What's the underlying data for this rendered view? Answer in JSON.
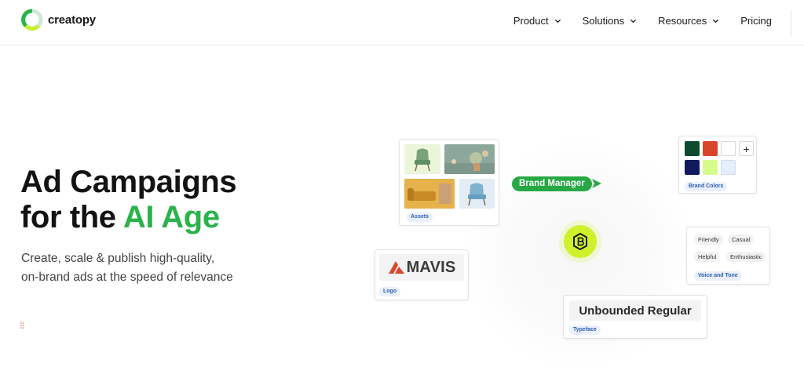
{
  "brand": {
    "name": "creatopy"
  },
  "nav": {
    "items": [
      {
        "label": "Product"
      },
      {
        "label": "Solutions"
      },
      {
        "label": "Resources"
      },
      {
        "label": "Pricing"
      }
    ]
  },
  "hero": {
    "title_line1": "Ad Campaigns",
    "title_line2_prefix": "for the ",
    "title_line2_highlight": "AI Age",
    "subtitle_line1": "Create, scale & publish high-quality,",
    "subtitle_line2": "on-brand ads at the speed of relevance"
  },
  "illustration": {
    "brand_manager_label": "Brand Manager",
    "assets_chip": "Assets",
    "brand_colors_chip": "Brand Colors",
    "add_symbol": "+",
    "swatches": [
      "#0f4a2f",
      "#d9452b",
      "#ffffff",
      "#101a5c",
      "#d7fb8c",
      "#e4eefc"
    ],
    "tones": [
      "Friendly",
      "Casual",
      "Helpful",
      "Enthusiastic"
    ],
    "voice_chip": "Voice and Tone",
    "logo_word": "MAVIS",
    "logo_chip": "Logo",
    "typeface_name": "Unbounded Regular",
    "typeface_chip": "Typeface"
  },
  "colors": {
    "accent": "#2bb34b",
    "pill": "#26a844",
    "badge": "#cdf22c",
    "logo_red": "#d9452b"
  }
}
